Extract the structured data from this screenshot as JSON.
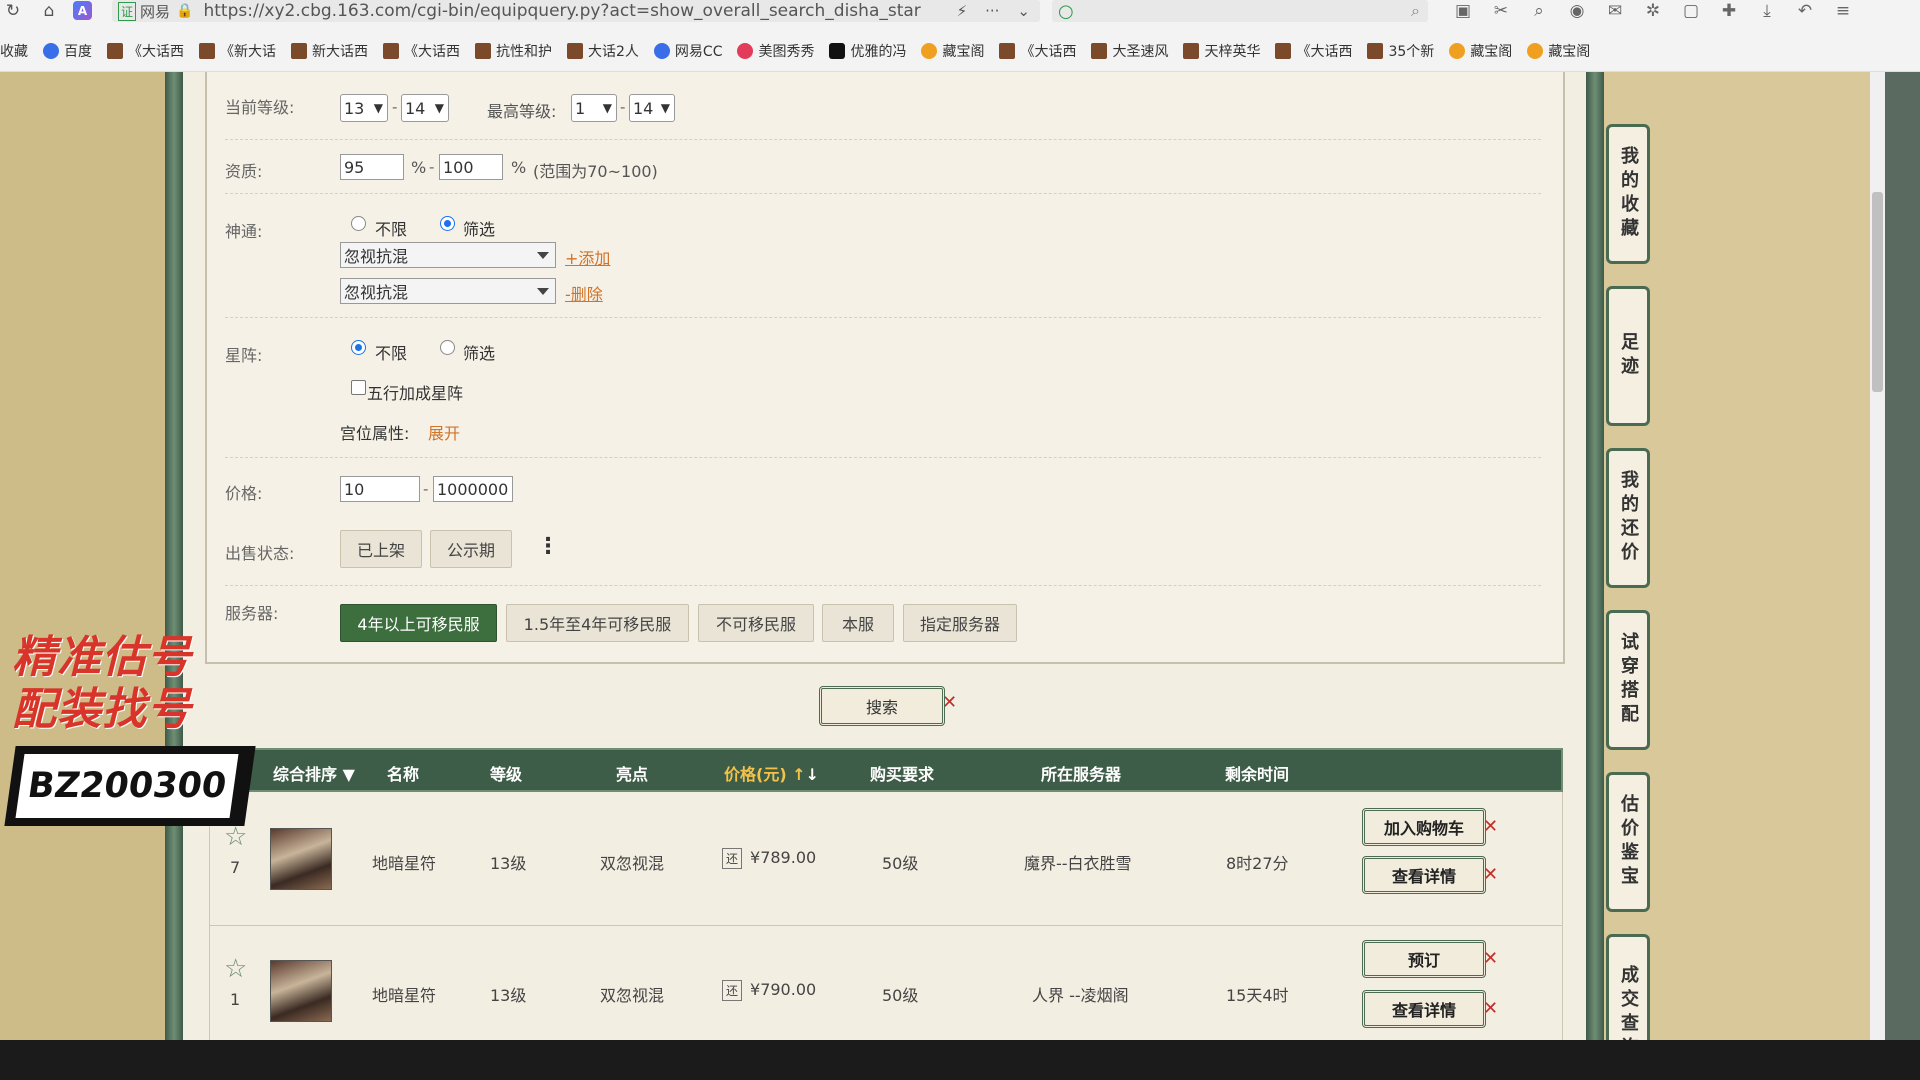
{
  "browser": {
    "url": "https://xy2.cbg.163.com/cgi-bin/equipquery.py?act=show_overall_search_disha_star",
    "cert_label": "证",
    "cert_name": "网易",
    "search_placeholder": "",
    "bookmarks": [
      {
        "label": "收藏",
        "icon": "star-icon"
      },
      {
        "label": "百度",
        "icon": "baidu-icon"
      },
      {
        "label": "《大话西",
        "icon": "game-icon"
      },
      {
        "label": "《新大话",
        "icon": "game-icon"
      },
      {
        "label": "新大话西",
        "icon": "game-icon"
      },
      {
        "label": "《大话西",
        "icon": "game-icon"
      },
      {
        "label": "抗性和护",
        "icon": "game-icon"
      },
      {
        "label": "大话2人",
        "icon": "game-icon"
      },
      {
        "label": "网易CC",
        "icon": "cc-icon"
      },
      {
        "label": "美图秀秀",
        "icon": "meitu-icon"
      },
      {
        "label": "优雅的冯",
        "icon": "tiktok-icon"
      },
      {
        "label": "藏宝阁",
        "icon": "cbg-icon"
      },
      {
        "label": "《大话西",
        "icon": "game-icon"
      },
      {
        "label": "大圣速风",
        "icon": "game-icon"
      },
      {
        "label": "天梓英华",
        "icon": "game-icon"
      },
      {
        "label": "《大话西",
        "icon": "game-icon"
      },
      {
        "label": "35个新",
        "icon": "game-icon"
      },
      {
        "label": "藏宝阁",
        "icon": "cbg-icon"
      },
      {
        "label": "藏宝阁",
        "icon": "cbg-icon"
      }
    ]
  },
  "form": {
    "level": {
      "label": "当前等级:",
      "min": "13",
      "max": "14",
      "max_label": "最高等级:",
      "max_min": "1",
      "max_max": "14"
    },
    "quality": {
      "label": "资质:",
      "min": "95",
      "max": "100",
      "unit": "%",
      "hint": "(范围为70~100)"
    },
    "shentong": {
      "label": "神通:",
      "opt_any": "不限",
      "opt_filter": "筛选",
      "select1": "忽视抗混",
      "select2": "忽视抗混",
      "add_link": "+添加",
      "del_link": "-删除"
    },
    "xingzhen": {
      "label": "星阵:",
      "opt_any": "不限",
      "opt_filter": "筛选",
      "checkbox": "五行加成星阵",
      "palace_label": "宫位属性:",
      "palace_link": "展开"
    },
    "price": {
      "label": "价格:",
      "min": "10",
      "max": "1000000"
    },
    "sale_status": {
      "label": "出售状态:",
      "btn_listed": "已上架",
      "btn_public": "公示期"
    },
    "server": {
      "label": "服务器:",
      "options": [
        "4年以上可移民服",
        "1.5年至4年可移民服",
        "不可移民服",
        "本服",
        "指定服务器"
      ],
      "active": "4年以上可移民服"
    },
    "search_btn": "搜索"
  },
  "table": {
    "headers": {
      "sort": "综合排序",
      "name": "名称",
      "level": "等级",
      "highlight": "亮点",
      "price": "价格(元)",
      "requirement": "购买要求",
      "server": "所在服务器",
      "time": "剩余时间"
    },
    "rows": [
      {
        "fav_count": "7",
        "name": "地暗星符",
        "level": "13级",
        "highlight": "双忽视混",
        "price_tag": "还",
        "price": "¥789.00",
        "requirement": "50级",
        "server": "魔界--白衣胜雪",
        "time": "8时27分",
        "btn1": "加入购物车",
        "btn2": "查看详情"
      },
      {
        "fav_count": "1",
        "name": "地暗星符",
        "level": "13级",
        "highlight": "双忽视混",
        "price_tag": "还",
        "price": "¥790.00",
        "requirement": "50级",
        "server": "人界 --凌烟阁",
        "time": "15天4时",
        "btn1": "预订",
        "btn2": "查看详情"
      }
    ]
  },
  "sidebar": {
    "tabs": [
      "我的收藏",
      "足迹",
      "我的还价",
      "试穿搭配",
      "估价鉴宝",
      "成交查询"
    ]
  },
  "overlay": {
    "line1": "精准估号",
    "line2": "配装找号",
    "code": "BZ200300"
  },
  "colors": {
    "active_green": "#3c6e3e",
    "header_green": "#3e5d48",
    "link_orange": "#d0742a",
    "price_gold": "#f2c24a",
    "ad_red": "#d9342a"
  }
}
